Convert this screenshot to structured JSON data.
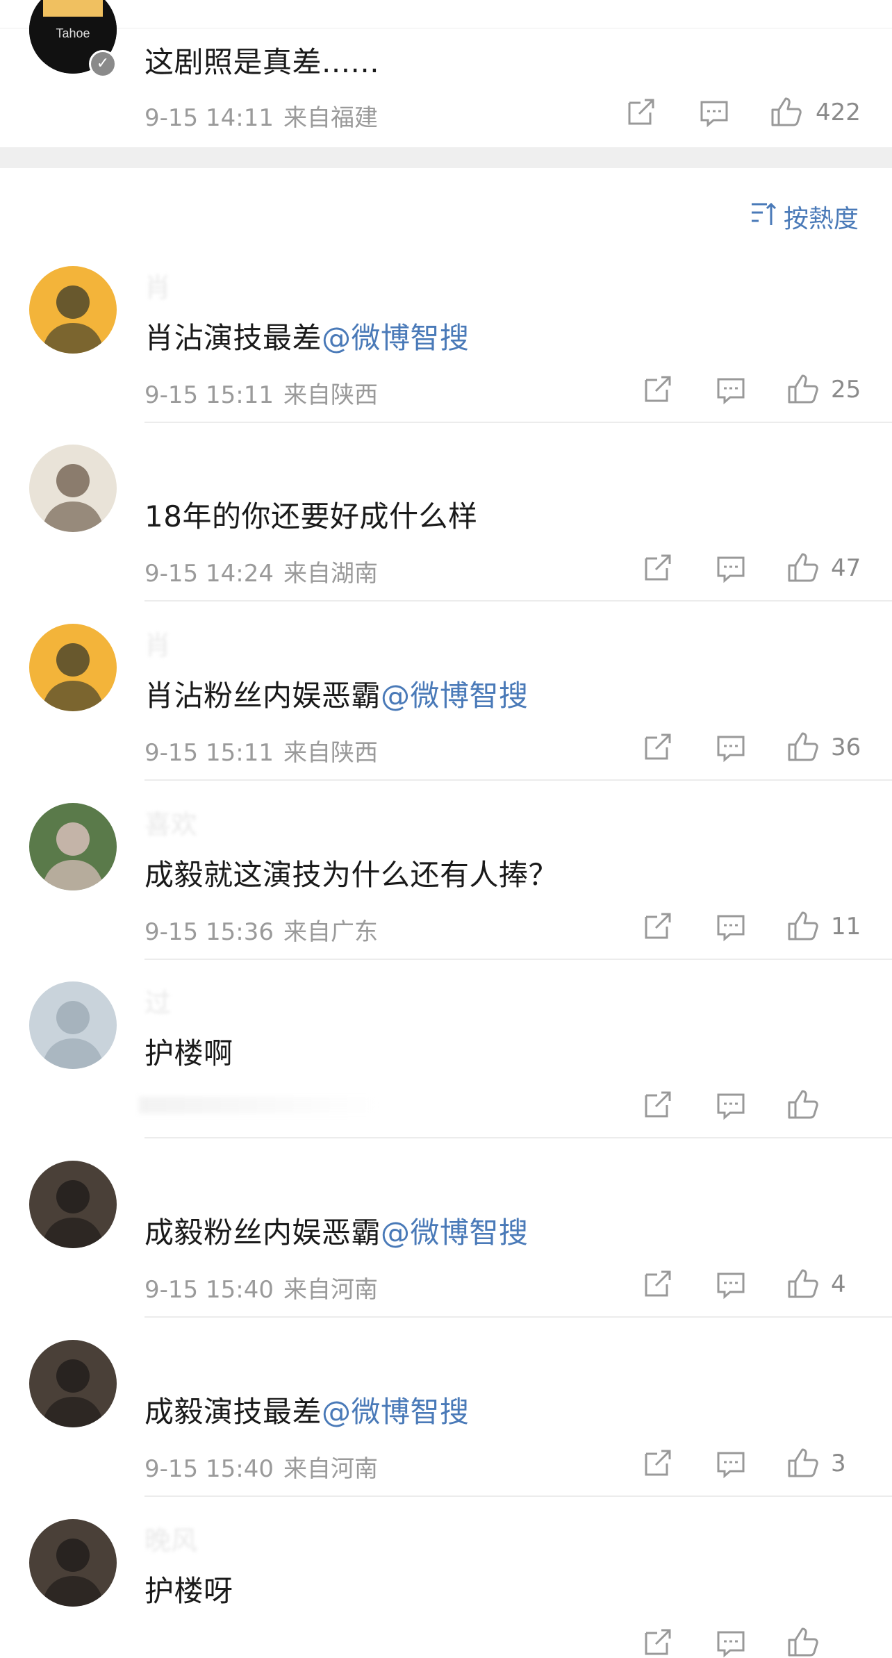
{
  "top_comment": {
    "avatar_text": "Tahoe",
    "text": "这剧照是真差......",
    "time": "9-15 14:11",
    "location": "来自福建",
    "likes": "422"
  },
  "sort_label": "按熱度",
  "comments": [
    {
      "username": "肖",
      "text": "肖沾演技最差",
      "mention": "@微博智搜",
      "time": "9-15 15:11",
      "location": "来自陕西",
      "likes": "25"
    },
    {
      "username": "",
      "text": "18年的你还要好成什么样",
      "mention": "",
      "time": "9-15 14:24",
      "location": "来自湖南",
      "likes": "47"
    },
    {
      "username": "肖",
      "text": "肖沾粉丝内娱恶霸",
      "mention": "@微博智搜",
      "time": "9-15 15:11",
      "location": "来自陕西",
      "likes": "36"
    },
    {
      "username": "喜欢",
      "text": "成毅就这演技为什么还有人捧？",
      "mention": "",
      "time": "9-15 15:36",
      "location": "来自广东",
      "likes": "11"
    },
    {
      "username": "过",
      "text": "护楼啊",
      "mention": "",
      "time": "",
      "location": "",
      "likes": ""
    },
    {
      "username": "",
      "text": "成毅粉丝内娱恶霸",
      "mention": "@微博智搜",
      "time": "9-15 15:40",
      "location": "来自河南",
      "likes": "4"
    },
    {
      "username": "",
      "text": "成毅演技最差",
      "mention": "@微博智搜",
      "time": "9-15 15:40",
      "location": "来自河南",
      "likes": "3"
    },
    {
      "username": "晚风",
      "text": "护楼呀",
      "mention": "",
      "time": "",
      "location": "",
      "likes": ""
    }
  ],
  "colors": {
    "mention": "#4a7ab8",
    "meta": "#9a9a9a",
    "divider": "#ececec"
  }
}
